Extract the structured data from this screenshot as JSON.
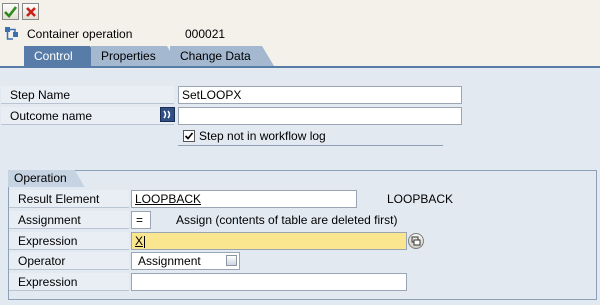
{
  "toolbar": {
    "check_icon": "check-icon",
    "cancel_icon": "cancel-icon"
  },
  "header": {
    "label": "Container operation",
    "value": "000021"
  },
  "tabs": [
    {
      "label": "Control",
      "active": true
    },
    {
      "label": "Properties",
      "active": false
    },
    {
      "label": "Change Data",
      "active": false
    }
  ],
  "form": {
    "step_name_label": "Step Name",
    "step_name_value": "SetLOOPX",
    "outcome_label": "Outcome name",
    "outcome_value": "",
    "checkbox_label": "Step not in workflow log",
    "checkbox_checked": true
  },
  "operation": {
    "title": "Operation",
    "result_element_label": "Result Element",
    "result_element_value": "LOOPBACK",
    "result_element_desc": "LOOPBACK",
    "assignment_label": "Assignment",
    "assignment_value": "=",
    "assignment_desc": "Assign (contents of table are deleted first)",
    "expression1_label": "Expression",
    "expression1_value": "X",
    "operator_label": "Operator",
    "operator_value": "Assignment",
    "expression2_label": "Expression",
    "expression2_value": ""
  },
  "colors": {
    "tab_active": "#587ca8",
    "panel": "#e2e9f1",
    "highlight_field": "#fbe690"
  }
}
